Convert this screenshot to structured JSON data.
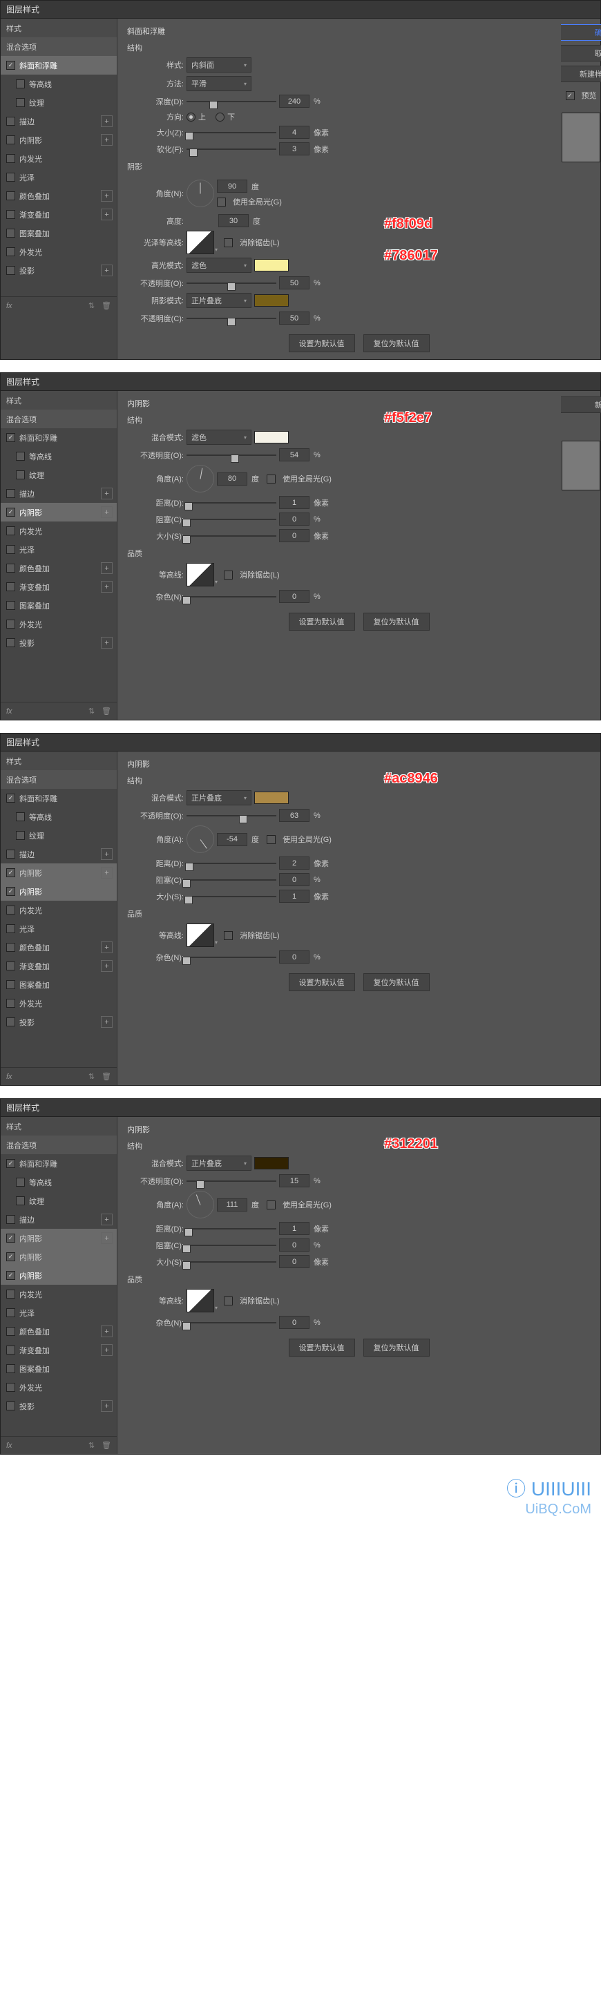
{
  "panel_title": "图层样式",
  "sidebar": {
    "styles": "样式",
    "blend_options": "混合选项",
    "bevel": "斜面和浮雕",
    "contour": "等高线",
    "texture": "纹理",
    "stroke": "描边",
    "inner_shadow": "内阴影",
    "inner_glow": "内发光",
    "satin": "光泽",
    "color_overlay": "颜色叠加",
    "gradient_overlay": "渐变叠加",
    "pattern_overlay": "图案叠加",
    "outer_glow": "外发光",
    "drop_shadow": "投影",
    "fx": "fx"
  },
  "right": {
    "ok": "确",
    "cancel": "取",
    "new_style": "新建样",
    "preview": "预览",
    "new_short": "新"
  },
  "p1": {
    "title": "斜面和浮雕",
    "struct": "结构",
    "style": "样式:",
    "style_val": "内斜面",
    "technique": "方法:",
    "technique_val": "平滑",
    "depth": "深度(D):",
    "depth_val": "240",
    "depth_unit": "%",
    "direction": "方向:",
    "up": "上",
    "down": "下",
    "size": "大小(Z):",
    "size_val": "4",
    "size_unit": "像素",
    "soften": "软化(F):",
    "soften_val": "3",
    "soften_unit": "像素",
    "shading": "阴影",
    "angle": "角度(N):",
    "angle_val": "90",
    "angle_unit": "度",
    "use_global": "使用全局光(G)",
    "altitude": "高度:",
    "altitude_val": "30",
    "altitude_unit": "度",
    "gloss": "光泽等高线:",
    "anti": "消除锯齿(L)",
    "hi_mode": "高光模式:",
    "hi_mode_val": "滤色",
    "hi_opacity": "不透明度(O):",
    "hi_opacity_val": "50",
    "hi_opacity_unit": "%",
    "sh_mode": "阴影模式:",
    "sh_mode_val": "正片叠底",
    "sh_opacity": "不透明度(C):",
    "sh_opacity_val": "50",
    "sh_opacity_unit": "%",
    "set_default": "设置为默认值",
    "reset_default": "复位为默认值",
    "color_hi": "#f8f09d",
    "color_sh": "#786017",
    "annot_hi": "#f8f09d",
    "annot_sh": "#786017"
  },
  "p2": {
    "title": "内阴影",
    "struct": "结构",
    "blend": "混合模式:",
    "blend_val": "滤色",
    "opacity": "不透明度(O):",
    "opacity_val": "54",
    "opacity_unit": "%",
    "angle": "角度(A):",
    "angle_val": "80",
    "angle_unit": "度",
    "use_global": "使用全局光(G)",
    "distance": "距离(D):",
    "distance_val": "1",
    "distance_unit": "像素",
    "choke": "阻塞(C):",
    "choke_val": "0",
    "choke_unit": "%",
    "size": "大小(S):",
    "size_val": "0",
    "size_unit": "像素",
    "quality": "品质",
    "contour": "等高线:",
    "anti": "消除锯齿(L)",
    "noise": "杂色(N):",
    "noise_val": "0",
    "noise_unit": "%",
    "set_default": "设置为默认值",
    "reset_default": "复位为默认值",
    "color": "#f5f2e7",
    "annot": "#f5f2e7"
  },
  "p3": {
    "title": "内阴影",
    "struct": "结构",
    "blend": "混合模式:",
    "blend_val": "正片叠底",
    "opacity": "不透明度(O):",
    "opacity_val": "63",
    "opacity_unit": "%",
    "angle": "角度(A):",
    "angle_val": "-54",
    "angle_unit": "度",
    "use_global": "使用全局光(G)",
    "distance": "距离(D):",
    "distance_val": "2",
    "distance_unit": "像素",
    "choke": "阻塞(C):",
    "choke_val": "0",
    "choke_unit": "%",
    "size": "大小(S):",
    "size_val": "1",
    "size_unit": "像素",
    "quality": "品质",
    "contour": "等高线:",
    "anti": "消除锯齿(L)",
    "noise": "杂色(N):",
    "noise_val": "0",
    "noise_unit": "%",
    "set_default": "设置为默认值",
    "reset_default": "复位为默认值",
    "color": "#ac8946",
    "annot": "#ac8946"
  },
  "p4": {
    "title": "内阴影",
    "struct": "结构",
    "blend": "混合模式:",
    "blend_val": "正片叠底",
    "opacity": "不透明度(O):",
    "opacity_val": "15",
    "opacity_unit": "%",
    "angle": "角度(A):",
    "angle_val": "111",
    "angle_unit": "度",
    "use_global": "使用全局光(G)",
    "distance": "距离(D):",
    "distance_val": "1",
    "distance_unit": "像素",
    "choke": "阻塞(C):",
    "choke_val": "0",
    "choke_unit": "%",
    "size": "大小(S):",
    "size_val": "0",
    "size_unit": "像素",
    "quality": "品质",
    "contour": "等高线:",
    "anti": "消除锯齿(L)",
    "noise": "杂色(N):",
    "noise_val": "0",
    "noise_unit": "%",
    "set_default": "设置为默认值",
    "reset_default": "复位为默认值",
    "color": "#312201",
    "annot": "#312201"
  },
  "watermark": {
    "logo": "ⓘ UIIIUIII",
    "url": "UiBQ.CoM"
  }
}
